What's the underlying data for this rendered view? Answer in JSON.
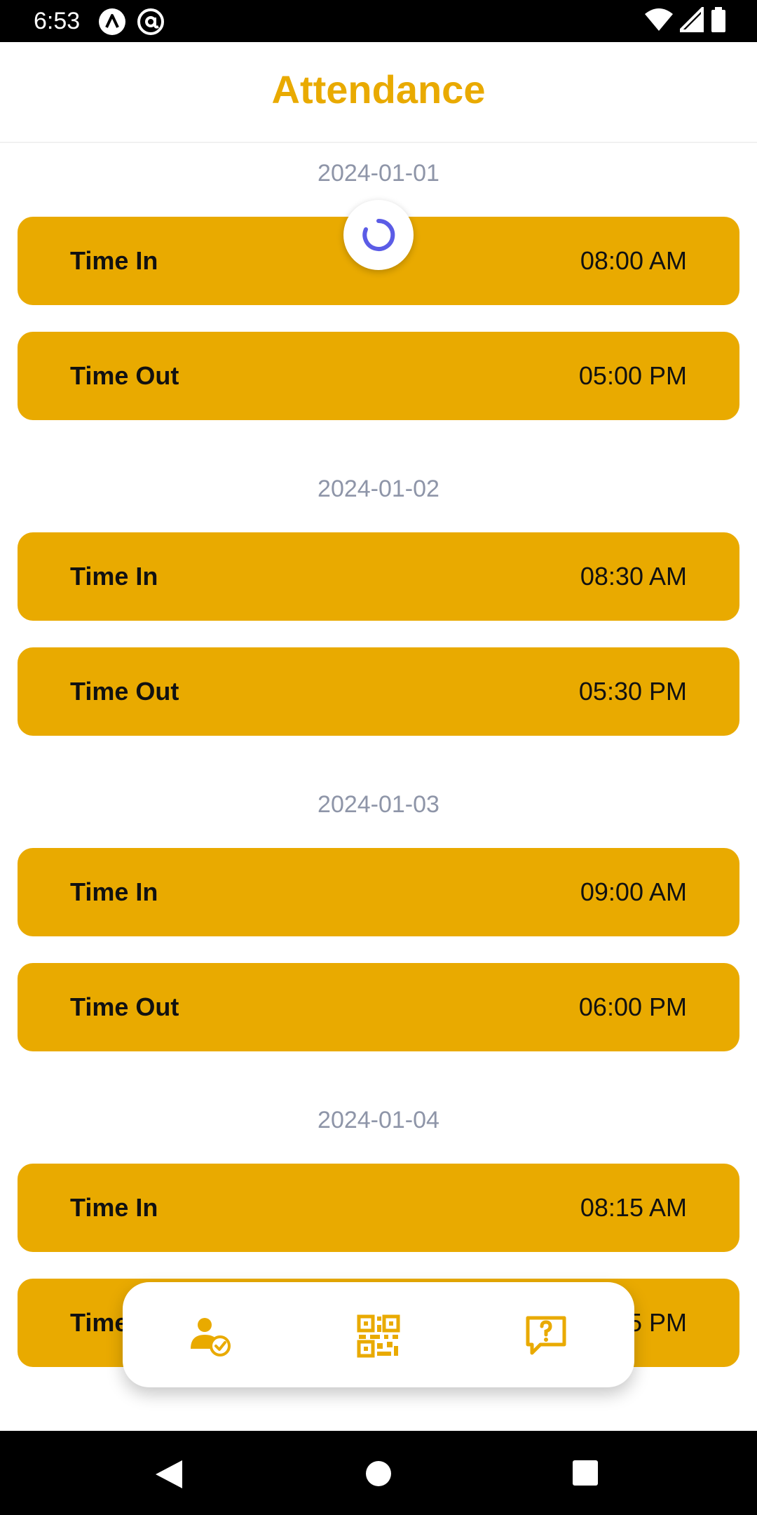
{
  "status_bar": {
    "time": "6:53"
  },
  "header": {
    "title": "Attendance"
  },
  "records": [
    {
      "date": "2024-01-01",
      "time_in_label": "Time In",
      "time_in": "08:00 AM",
      "time_out_label": "Time Out",
      "time_out": "05:00 PM"
    },
    {
      "date": "2024-01-02",
      "time_in_label": "Time In",
      "time_in": "08:30 AM",
      "time_out_label": "Time Out",
      "time_out": "05:30 PM"
    },
    {
      "date": "2024-01-03",
      "time_in_label": "Time In",
      "time_in": "09:00 AM",
      "time_out_label": "Time Out",
      "time_out": "06:00 PM"
    },
    {
      "date": "2024-01-04",
      "time_in_label": "Time In",
      "time_in": "08:15 AM",
      "time_out_label": "Time",
      "time_out": "5 PM"
    }
  ],
  "bottom_nav": {
    "items": [
      {
        "icon": "user-check-icon"
      },
      {
        "icon": "qr-code-icon"
      },
      {
        "icon": "help-message-icon"
      }
    ]
  },
  "colors": {
    "accent": "#E9AA00",
    "date_text": "#8E95A8",
    "spinner": "#5B5CE6"
  }
}
